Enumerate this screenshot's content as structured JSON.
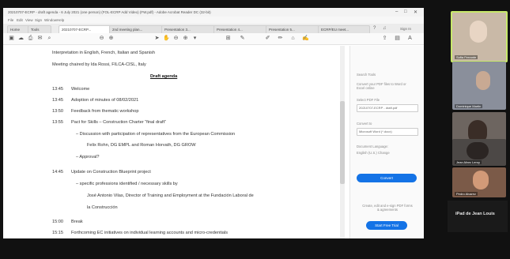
{
  "window": {
    "title": "20210707-ECRP - draft agenda - 6 July 2021 (one person) (FOL-ECRP Add Video) (FW.pdf) - Adobe Acrobat Reader DC (32-bit)",
    "menu": [
      "File",
      "Edit",
      "View",
      "Sign",
      "Window",
      "Help"
    ]
  },
  "tabs": [
    "Home",
    "Tools",
    "20210707-ECRP...",
    "2nd meeting plan...",
    "Presentation 3...",
    "Presentation 4...",
    "Presentation 5...",
    "ECRP/EU meet..."
  ],
  "account": "Sign In",
  "agenda": {
    "interpretation": "Interpretation in English, French, Italian and Spanish",
    "chair": "Meeting chaired by Ida Rossi, FILCA-CISL, Italy",
    "title": "Draft agenda",
    "items": [
      {
        "time": "13:45",
        "text": "Welcome"
      },
      {
        "time": "13:45",
        "text": "Adoption of minutes of 08/02/2021"
      },
      {
        "time": "13:50",
        "text": "Feedback from thematic workshop"
      },
      {
        "time": "13:55",
        "text": "Pact for Skills – Construction Charter “final draft”"
      },
      {
        "time": "",
        "text": "–    Discussion with participation of representatives from the European Commission"
      },
      {
        "time": "",
        "text": "Felix Rohn, DG EMPL and Roman Horvath, DG GROW"
      },
      {
        "time": "",
        "text": "–    Approval?"
      },
      {
        "time": "14:45",
        "text": "Update on Construction Blueprint project"
      },
      {
        "time": "",
        "text": "–    specific professions identified / necessary skills by"
      },
      {
        "time": "",
        "text": "José Antonio Vilas, Director of Training and Employment at the Fundación Laboral de"
      },
      {
        "time": "",
        "text": "la Construcción"
      },
      {
        "time": "15:00",
        "text": "Break"
      },
      {
        "time": "15:15",
        "text": "Forthcoming EC initiatives on individual learning accounts and micro-credentials"
      }
    ]
  },
  "rightpane": {
    "search": "Search Tools",
    "convert_note": "Convert your PDF files to Word or Excel online",
    "select_label": "Select PDF File",
    "select_value": "20210707-ECRP - draft.pdf",
    "convert_to": "Convert to",
    "format_value": "Microsoft Word (*.docx)",
    "language_label": "Document Language:",
    "language_value": "English (U.S.) Change",
    "convert_btn": "Convert",
    "promo": "Create, edit and e-sign PDF forms & agreements",
    "trial_btn": "Start Free Trial"
  },
  "participants": [
    {
      "name": "Sofia Ferrante",
      "color": "#c9b9a7"
    },
    {
      "name": "Dominique Martin",
      "color": "#8a8f9b"
    },
    {
      "name": "Laura Bianchi",
      "color": "#6d6560"
    },
    {
      "name": "Jean-Marc Leroy",
      "color": "#4c4846"
    },
    {
      "name": "Pedro Alvarez",
      "color": "#7b5a48"
    }
  ],
  "bottom_participant": "iPad de Jean Louis",
  "colors": {
    "accent": "#1473e6",
    "active_speaker": "#c7e86a"
  }
}
